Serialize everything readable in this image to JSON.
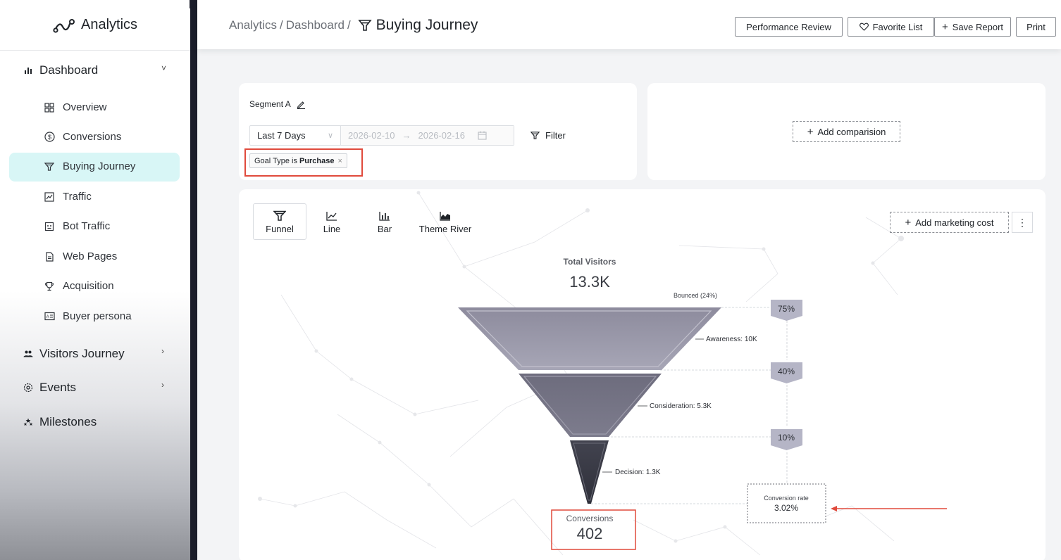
{
  "app": {
    "title": "Analytics"
  },
  "sidebar": {
    "items": [
      {
        "label": "Dashboard"
      },
      {
        "label": "Overview"
      },
      {
        "label": "Conversions"
      },
      {
        "label": "Buying Journey"
      },
      {
        "label": "Traffic"
      },
      {
        "label": "Bot Traffic"
      },
      {
        "label": "Web Pages"
      },
      {
        "label": "Acquisition"
      },
      {
        "label": "Buyer persona"
      },
      {
        "label": "Visitors Journey"
      },
      {
        "label": "Events"
      },
      {
        "label": "Milestones"
      }
    ]
  },
  "header": {
    "breadcrumb": [
      "Analytics",
      "Dashboard"
    ],
    "page_title": "Buying Journey",
    "buttons": {
      "performance": "Performance Review",
      "favorite": "Favorite List",
      "save": "Save Report",
      "print": "Print"
    }
  },
  "segment": {
    "name": "Segment A",
    "date_preset": "Last 7 Days",
    "date_from": "2026-02-10",
    "date_to": "2026-02-16",
    "filter_label": "Filter",
    "chip_prefix": "Goal Type is",
    "chip_value": "Purchase"
  },
  "comparison": {
    "add_label": "Add comparision"
  },
  "chart_tabs": [
    "Funnel",
    "Line",
    "Bar",
    "Theme River"
  ],
  "chart_toolbar": {
    "add_cost": "Add marketing cost"
  },
  "colors": {
    "accent_bg": "#d8f6f6",
    "highlight": "#e04a3c",
    "funnel_dark": "#3a3b46",
    "funnel_light": "#9b9aab"
  },
  "chart_data": {
    "type": "funnel",
    "total": {
      "label": "Total Visitors",
      "value": "13.3K"
    },
    "bounced": "Bounced (24%)",
    "stages": [
      {
        "label": "Awareness: 10K",
        "value": 10000
      },
      {
        "label": "Consideration: 5.3K",
        "value": 5300
      },
      {
        "label": "Decision: 1.3K",
        "value": 1300
      }
    ],
    "step_rates": [
      "75%",
      "40%",
      "10%"
    ],
    "conversion_rate": {
      "label": "Conversion rate",
      "value": "3.02%"
    },
    "conversions": {
      "label": "Conversions",
      "value": "402"
    }
  }
}
